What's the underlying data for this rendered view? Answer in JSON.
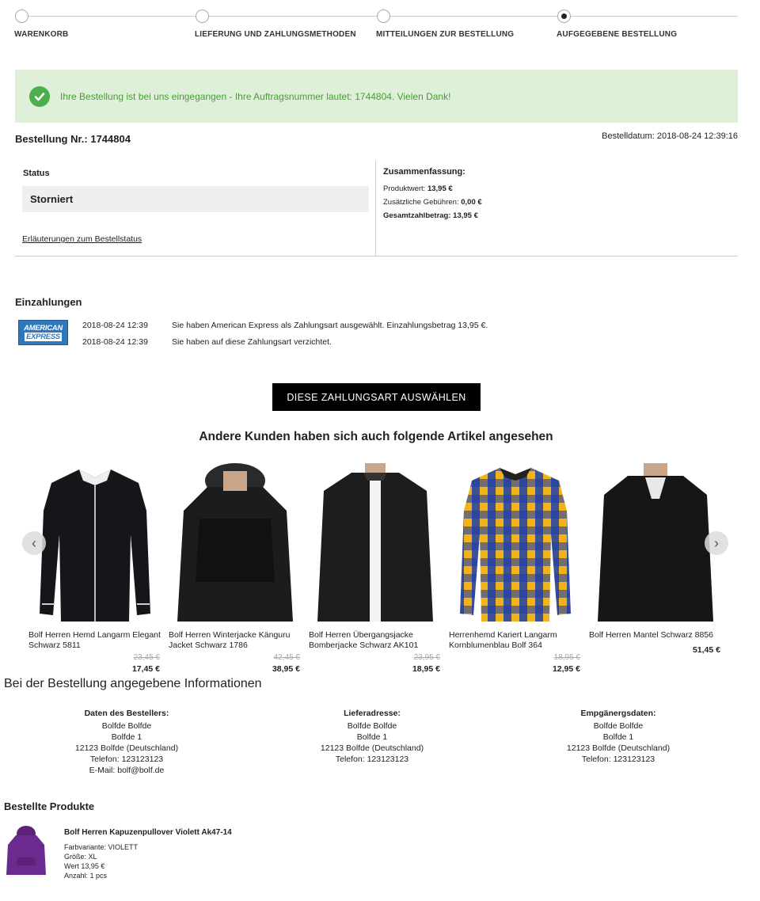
{
  "steps": [
    "WARENKORB",
    "LIEFERUNG UND ZAHLUNGSMETHODEN",
    "MITTEILUNGEN ZUR BESTELLUNG",
    "AUFGEGEBENE BESTELLUNG"
  ],
  "success_message": "Ihre Bestellung ist bei uns eingegangen - Ihre Auftragsnummer lautet: 1744804. Vielen Dank!",
  "order": {
    "number_label": "Bestellung Nr.: 1744804",
    "date_label": "Bestelldatum: 2018-08-24 12:39:16",
    "status_label": "Status",
    "status_value": "Storniert",
    "status_link": "Erläuterungen zum Bestellstatus",
    "summary": {
      "heading": "Zusammenfassung:",
      "product_value_label": "Produktwert:",
      "product_value": "13,95 €",
      "fees_label": "Zusätzliche Gebühren:",
      "fees": "0,00 €",
      "total_label": "Gesamtzahlbetrag:",
      "total": "13,95 €"
    }
  },
  "payments": {
    "heading": "Einzahlungen",
    "logo_line1": "AMERICAN",
    "logo_line2": "EXPRESS",
    "rows": [
      {
        "time": "2018-08-24 12:39",
        "text": "Sie haben American Express als Zahlungsart ausgewählt. Einzahlungsbetrag 13,95 €."
      },
      {
        "time": "2018-08-24 12:39",
        "text": "Sie haben auf diese Zahlungsart verzichtet."
      }
    ],
    "button": "DIESE ZAHLUNGSART AUSWÄHLEN"
  },
  "recommendations": {
    "heading": "Andere Kunden haben sich auch folgende Artikel angesehen",
    "items": [
      {
        "name": "Bolf Herren Hemd Langarm Elegant Schwarz 5811",
        "old_price": "23,45 €",
        "price": "17,45 €"
      },
      {
        "name": "Bolf Herren Winterjacke Känguru Jacket Schwarz 1786",
        "old_price": "42,45 €",
        "price": "38,95 €"
      },
      {
        "name": "Bolf Herren Übergangsjacke Bomberjacke Schwarz AK101",
        "old_price": "23,95 €",
        "price": "18,95 €"
      },
      {
        "name": "Herrenhemd Kariert Langarm Kornblumenblau Bolf 364",
        "old_price": "18,95 €",
        "price": "12,95 €"
      },
      {
        "name": "Bolf Herren Mantel Schwarz 8856",
        "old_price": "",
        "price": "51,45 €"
      }
    ]
  },
  "info": {
    "heading": "Bei der Bestellung angegebene Informationen",
    "orderer": {
      "heading": "Daten des Bestellers:",
      "lines": [
        "Bolfde Bolfde",
        "Bolfde 1",
        "12123 Bolfde (Deutschland)",
        "Telefon: 123123123",
        "E-Mail: bolf@bolf.de"
      ]
    },
    "delivery": {
      "heading": "Lieferadresse:",
      "lines": [
        "Bolfde Bolfde",
        "Bolfde 1",
        "12123 Bolfde (Deutschland)",
        "Telefon: 123123123"
      ]
    },
    "recipient": {
      "heading": "Empgänergsdaten:",
      "lines": [
        "Bolfde Bolfde",
        "Bolfde 1",
        "12123 Bolfde (Deutschland)",
        "Telefon: 123123123"
      ]
    }
  },
  "ordered_products": {
    "heading": "Bestellte Produkte",
    "item": {
      "title": "Bolf Herren Kapuzenpullover Violett Ak47-14",
      "variant": "Farbvariante: VIOLETT",
      "size": "Größe: XL",
      "value": "Wert 13,95 €",
      "quantity": "Anzahl: 1 pcs"
    }
  },
  "colors": {
    "success_bg": "#dff0d8",
    "success_text": "#4a9a3a",
    "amex_blue": "#2e77bc",
    "shirt_yellow": "#f2b21c",
    "shirt_blue": "#1f3fa8",
    "hoodie_violet": "#6b2a8f"
  }
}
